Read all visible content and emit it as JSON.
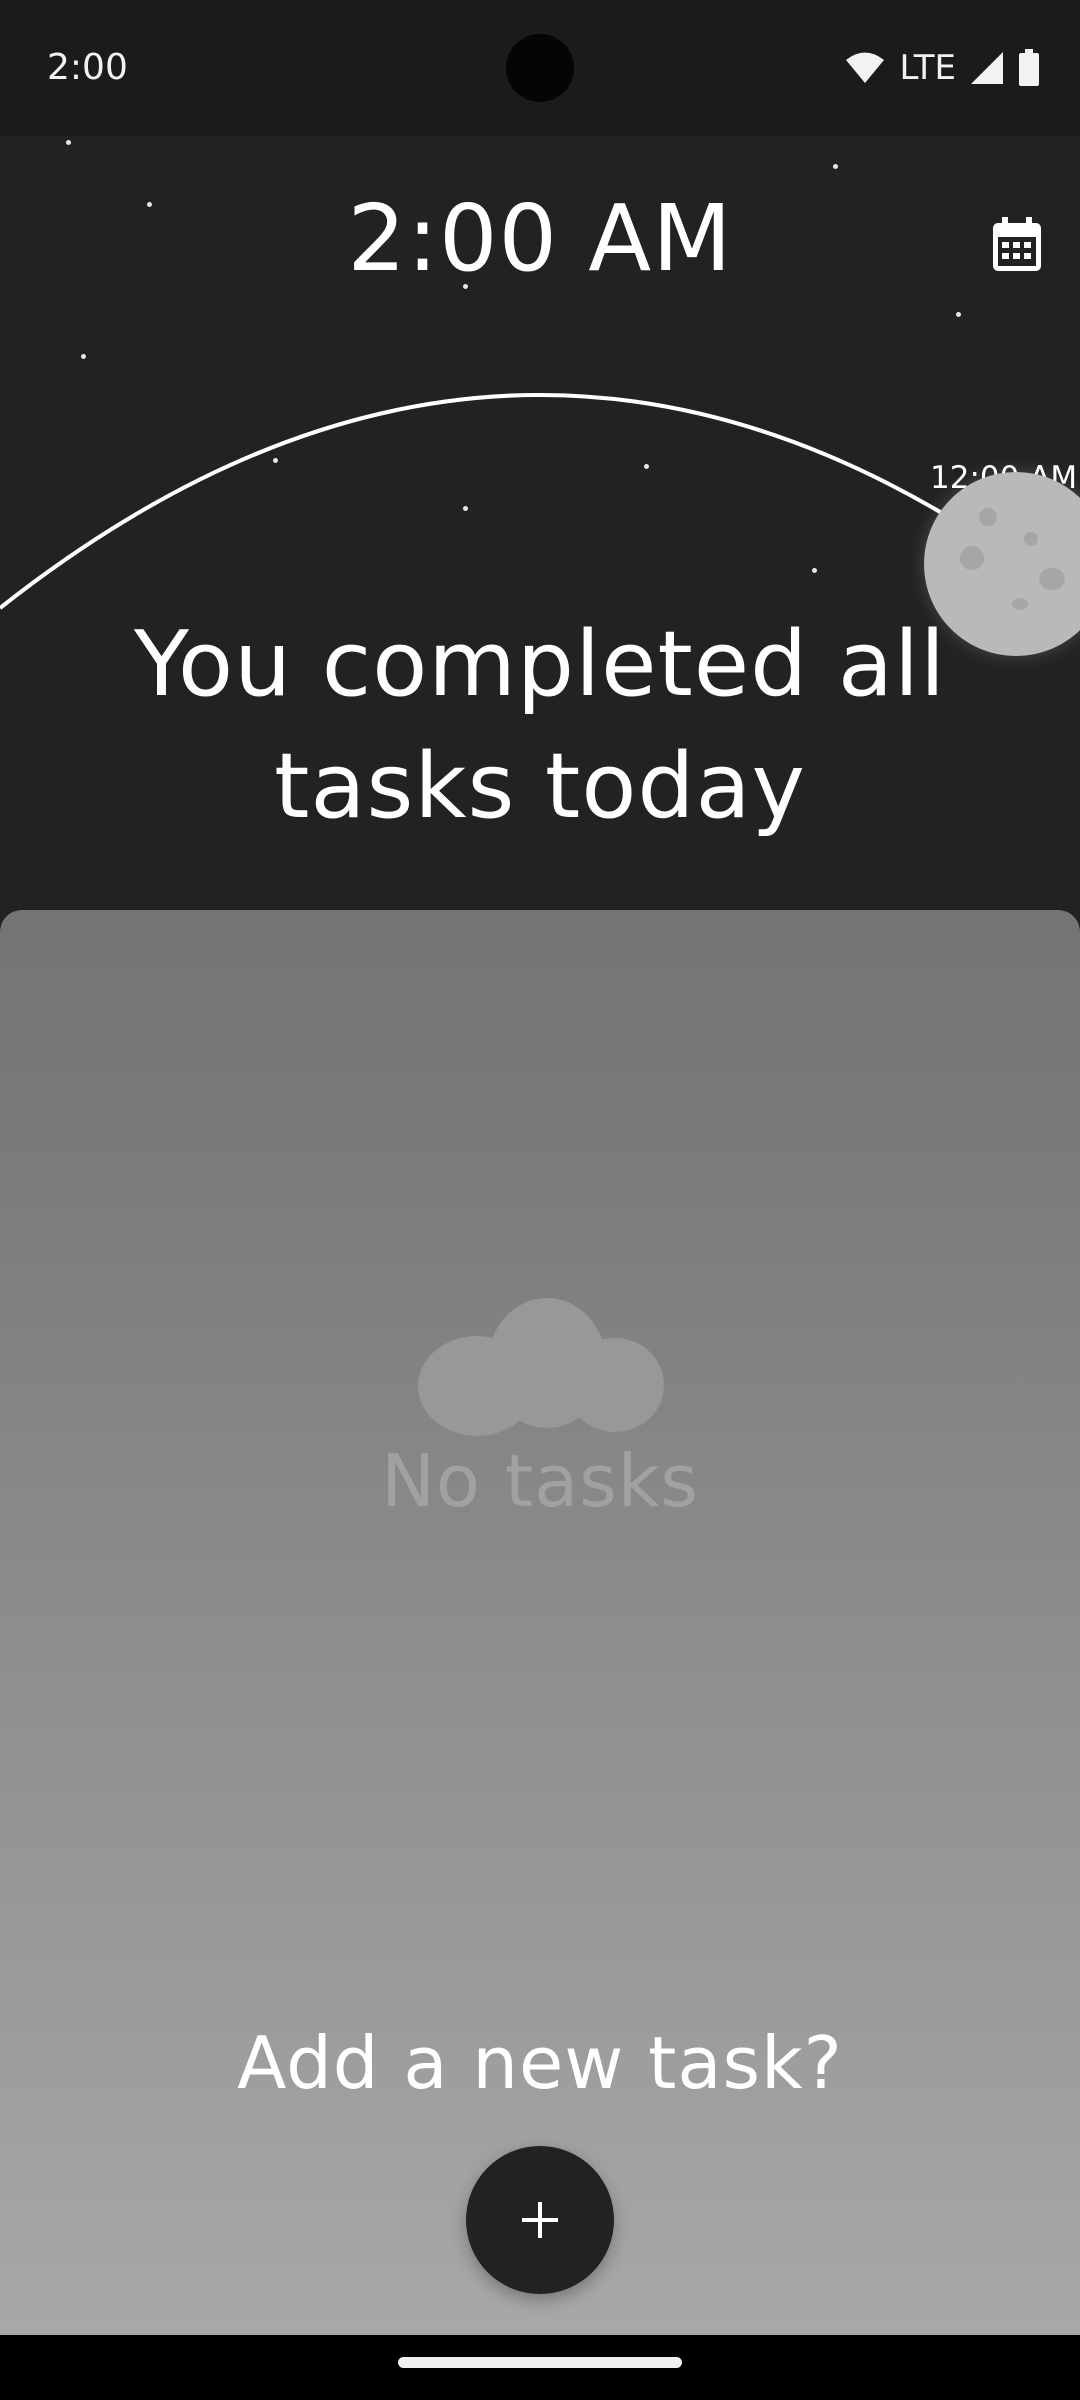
{
  "status_bar": {
    "time": "2:00",
    "network": "LTE",
    "icons": [
      "wifi-icon",
      "signal-icon",
      "battery-icon"
    ]
  },
  "header": {
    "current_time": "2:00 AM",
    "calendar_icon": "calendar-icon",
    "arc_time_label": "12:00 AM",
    "celestial_icon": "moon-icon",
    "message": "You completed all tasks today"
  },
  "tasks": {
    "empty_icon": "cloud-icon",
    "empty_label": "No tasks",
    "add_prompt": "Add a new task?",
    "add_icon": "plus-icon"
  },
  "colors": {
    "background": "#222222",
    "panel_top": "#747474",
    "panel_bottom": "#a8a8a8",
    "moon": "#b9b9b9",
    "fab": "#222222"
  }
}
